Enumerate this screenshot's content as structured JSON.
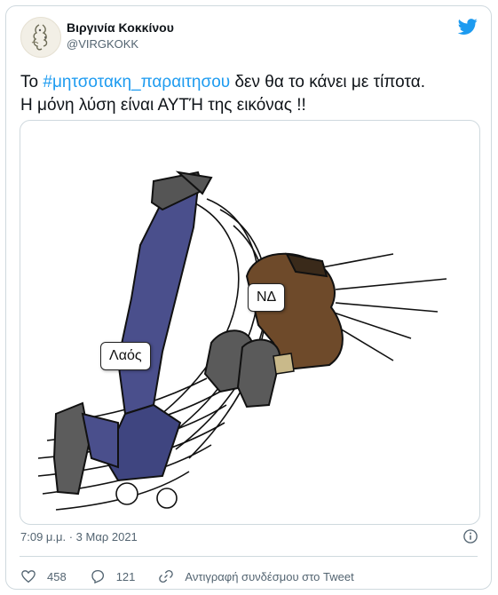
{
  "tweet": {
    "author_name": "Βιργινία Κοκκίνου",
    "author_handle": "@VIRGKOKK",
    "text_prefix": "Το ",
    "hashtag": "#μητσοτακη_παραιτησου",
    "text_suffix": " δεν θα το κάνει με τίποτα.",
    "text_line2": "Η μόνη λύση είναι ΑΥΤΉ της εικόνας !!",
    "timestamp": "7:09 μ.μ. · 3 Μαρ 2021"
  },
  "image": {
    "label_people": "Λαός",
    "label_party": "ΝΔ"
  },
  "actions": {
    "likes": "458",
    "replies": "121",
    "copy_link": "Αντιγραφή συνδέσμου στο Tweet"
  },
  "icons": {
    "brand": "twitter-bird-icon",
    "info": "info-icon",
    "like": "heart-icon",
    "reply": "reply-icon",
    "link": "link-icon"
  },
  "colors": {
    "accent": "#1d9bf0",
    "text": "#0f1419",
    "muted": "#536471",
    "border": "#cfd9de"
  }
}
